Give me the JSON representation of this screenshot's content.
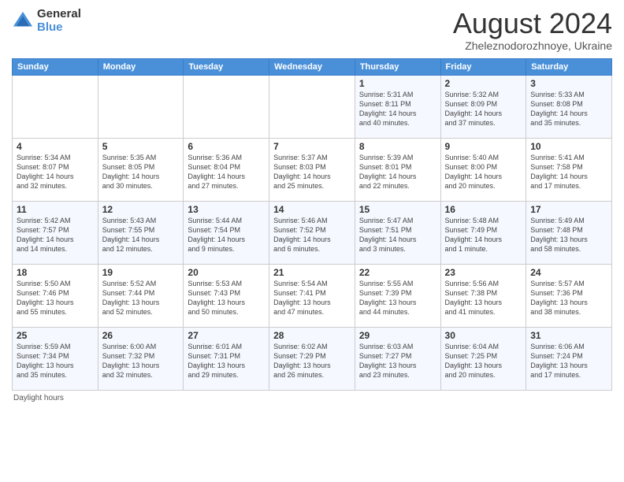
{
  "logo": {
    "general": "General",
    "blue": "Blue"
  },
  "title": "August 2024",
  "subtitle": "Zheleznodorozhnoye, Ukraine",
  "days_of_week": [
    "Sunday",
    "Monday",
    "Tuesday",
    "Wednesday",
    "Thursday",
    "Friday",
    "Saturday"
  ],
  "weeks": [
    [
      {
        "day": "",
        "info": ""
      },
      {
        "day": "",
        "info": ""
      },
      {
        "day": "",
        "info": ""
      },
      {
        "day": "",
        "info": ""
      },
      {
        "day": "1",
        "info": "Sunrise: 5:31 AM\nSunset: 8:11 PM\nDaylight: 14 hours\nand 40 minutes."
      },
      {
        "day": "2",
        "info": "Sunrise: 5:32 AM\nSunset: 8:09 PM\nDaylight: 14 hours\nand 37 minutes."
      },
      {
        "day": "3",
        "info": "Sunrise: 5:33 AM\nSunset: 8:08 PM\nDaylight: 14 hours\nand 35 minutes."
      }
    ],
    [
      {
        "day": "4",
        "info": "Sunrise: 5:34 AM\nSunset: 8:07 PM\nDaylight: 14 hours\nand 32 minutes."
      },
      {
        "day": "5",
        "info": "Sunrise: 5:35 AM\nSunset: 8:05 PM\nDaylight: 14 hours\nand 30 minutes."
      },
      {
        "day": "6",
        "info": "Sunrise: 5:36 AM\nSunset: 8:04 PM\nDaylight: 14 hours\nand 27 minutes."
      },
      {
        "day": "7",
        "info": "Sunrise: 5:37 AM\nSunset: 8:03 PM\nDaylight: 14 hours\nand 25 minutes."
      },
      {
        "day": "8",
        "info": "Sunrise: 5:39 AM\nSunset: 8:01 PM\nDaylight: 14 hours\nand 22 minutes."
      },
      {
        "day": "9",
        "info": "Sunrise: 5:40 AM\nSunset: 8:00 PM\nDaylight: 14 hours\nand 20 minutes."
      },
      {
        "day": "10",
        "info": "Sunrise: 5:41 AM\nSunset: 7:58 PM\nDaylight: 14 hours\nand 17 minutes."
      }
    ],
    [
      {
        "day": "11",
        "info": "Sunrise: 5:42 AM\nSunset: 7:57 PM\nDaylight: 14 hours\nand 14 minutes."
      },
      {
        "day": "12",
        "info": "Sunrise: 5:43 AM\nSunset: 7:55 PM\nDaylight: 14 hours\nand 12 minutes."
      },
      {
        "day": "13",
        "info": "Sunrise: 5:44 AM\nSunset: 7:54 PM\nDaylight: 14 hours\nand 9 minutes."
      },
      {
        "day": "14",
        "info": "Sunrise: 5:46 AM\nSunset: 7:52 PM\nDaylight: 14 hours\nand 6 minutes."
      },
      {
        "day": "15",
        "info": "Sunrise: 5:47 AM\nSunset: 7:51 PM\nDaylight: 14 hours\nand 3 minutes."
      },
      {
        "day": "16",
        "info": "Sunrise: 5:48 AM\nSunset: 7:49 PM\nDaylight: 14 hours\nand 1 minute."
      },
      {
        "day": "17",
        "info": "Sunrise: 5:49 AM\nSunset: 7:48 PM\nDaylight: 13 hours\nand 58 minutes."
      }
    ],
    [
      {
        "day": "18",
        "info": "Sunrise: 5:50 AM\nSunset: 7:46 PM\nDaylight: 13 hours\nand 55 minutes."
      },
      {
        "day": "19",
        "info": "Sunrise: 5:52 AM\nSunset: 7:44 PM\nDaylight: 13 hours\nand 52 minutes."
      },
      {
        "day": "20",
        "info": "Sunrise: 5:53 AM\nSunset: 7:43 PM\nDaylight: 13 hours\nand 50 minutes."
      },
      {
        "day": "21",
        "info": "Sunrise: 5:54 AM\nSunset: 7:41 PM\nDaylight: 13 hours\nand 47 minutes."
      },
      {
        "day": "22",
        "info": "Sunrise: 5:55 AM\nSunset: 7:39 PM\nDaylight: 13 hours\nand 44 minutes."
      },
      {
        "day": "23",
        "info": "Sunrise: 5:56 AM\nSunset: 7:38 PM\nDaylight: 13 hours\nand 41 minutes."
      },
      {
        "day": "24",
        "info": "Sunrise: 5:57 AM\nSunset: 7:36 PM\nDaylight: 13 hours\nand 38 minutes."
      }
    ],
    [
      {
        "day": "25",
        "info": "Sunrise: 5:59 AM\nSunset: 7:34 PM\nDaylight: 13 hours\nand 35 minutes."
      },
      {
        "day": "26",
        "info": "Sunrise: 6:00 AM\nSunset: 7:32 PM\nDaylight: 13 hours\nand 32 minutes."
      },
      {
        "day": "27",
        "info": "Sunrise: 6:01 AM\nSunset: 7:31 PM\nDaylight: 13 hours\nand 29 minutes."
      },
      {
        "day": "28",
        "info": "Sunrise: 6:02 AM\nSunset: 7:29 PM\nDaylight: 13 hours\nand 26 minutes."
      },
      {
        "day": "29",
        "info": "Sunrise: 6:03 AM\nSunset: 7:27 PM\nDaylight: 13 hours\nand 23 minutes."
      },
      {
        "day": "30",
        "info": "Sunrise: 6:04 AM\nSunset: 7:25 PM\nDaylight: 13 hours\nand 20 minutes."
      },
      {
        "day": "31",
        "info": "Sunrise: 6:06 AM\nSunset: 7:24 PM\nDaylight: 13 hours\nand 17 minutes."
      }
    ]
  ],
  "footer": "Daylight hours"
}
